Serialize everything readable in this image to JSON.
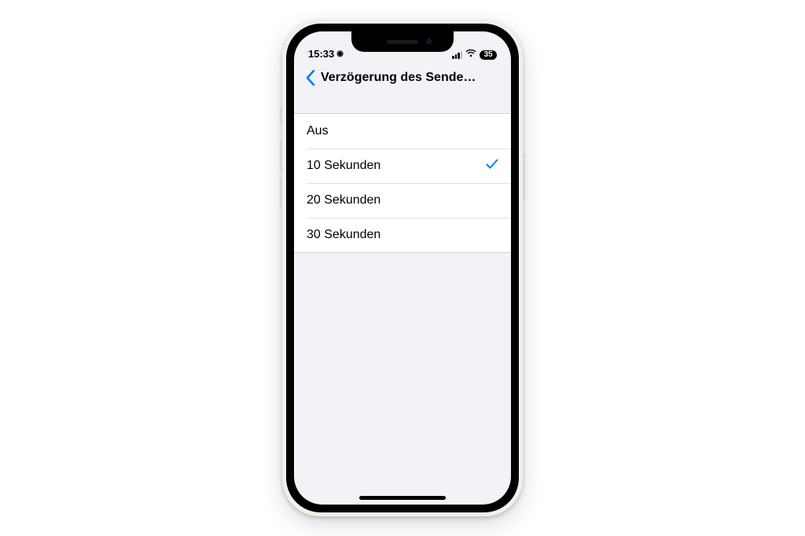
{
  "status": {
    "time": "15:33",
    "location_icon": "◉",
    "battery": "35"
  },
  "header": {
    "title": "Verzögerung des Sendewider…"
  },
  "options": [
    {
      "label": "Aus",
      "selected": false
    },
    {
      "label": "10 Sekunden",
      "selected": true
    },
    {
      "label": "20 Sekunden",
      "selected": false
    },
    {
      "label": "30 Sekunden",
      "selected": false
    }
  ]
}
